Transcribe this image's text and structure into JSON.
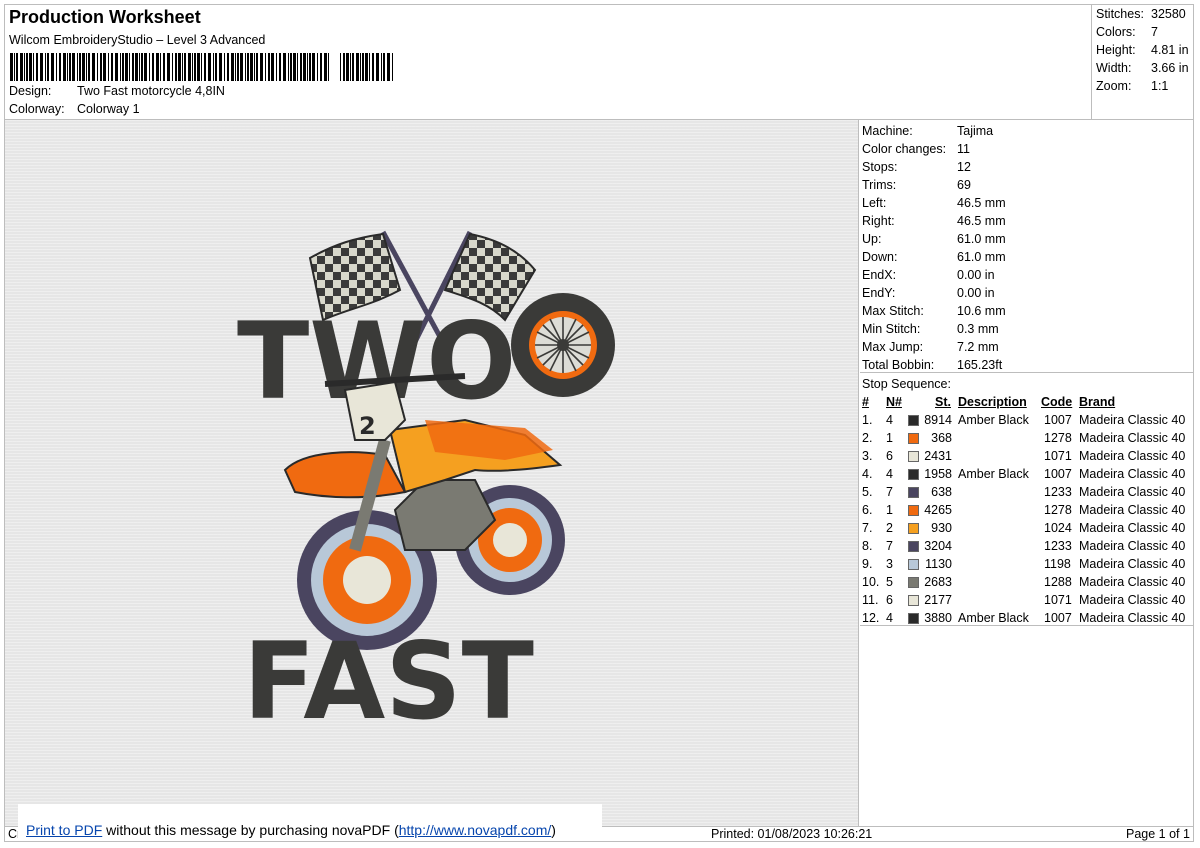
{
  "header": {
    "title": "Production Worksheet",
    "subtitle": "Wilcom EmbroideryStudio – Level 3 Advanced",
    "design_label": "Design:",
    "design_value": "Two Fast motorcycle 4,8IN",
    "colorway_label": "Colorway:",
    "colorway_value": "Colorway 1"
  },
  "summary": [
    {
      "label": "Stitches:",
      "value": "32580"
    },
    {
      "label": "Colors:",
      "value": "7"
    },
    {
      "label": "Height:",
      "value": "4.81 in"
    },
    {
      "label": "Width:",
      "value": "3.66 in"
    },
    {
      "label": "Zoom:",
      "value": "1:1"
    }
  ],
  "machine": [
    {
      "label": "Machine:",
      "value": "Tajima"
    },
    {
      "label": "Color changes:",
      "value": "11"
    },
    {
      "label": "Stops:",
      "value": "12"
    },
    {
      "label": "Trims:",
      "value": "69"
    },
    {
      "label": "Left:",
      "value": "46.5 mm"
    },
    {
      "label": "Right:",
      "value": "46.5 mm"
    },
    {
      "label": "Up:",
      "value": "61.0 mm"
    },
    {
      "label": "Down:",
      "value": "61.0 mm"
    },
    {
      "label": "EndX:",
      "value": "0.00 in"
    },
    {
      "label": "EndY:",
      "value": "0.00 in"
    },
    {
      "label": "Max Stitch:",
      "value": "10.6 mm"
    },
    {
      "label": "Min Stitch:",
      "value": "0.3 mm"
    },
    {
      "label": "Max Jump:",
      "value": "7.2 mm"
    },
    {
      "label": "Total Bobbin:",
      "value": "165.23ft"
    }
  ],
  "stop_sequence": {
    "title": "Stop Sequence:",
    "headers": {
      "num": "#",
      "n": "N#",
      "st": "St.",
      "desc": "Description",
      "code": "Code",
      "brand": "Brand"
    },
    "rows": [
      {
        "num": "1.",
        "n": "4",
        "color": "#2a2a2a",
        "st": "8914",
        "desc": "Amber Black",
        "code": "1007",
        "brand": "Madeira Classic 40"
      },
      {
        "num": "2.",
        "n": "1",
        "color": "#f06a10",
        "st": "368",
        "desc": "",
        "code": "1278",
        "brand": "Madeira Classic 40"
      },
      {
        "num": "3.",
        "n": "6",
        "color": "#e8e6d8",
        "st": "2431",
        "desc": "",
        "code": "1071",
        "brand": "Madeira Classic 40"
      },
      {
        "num": "4.",
        "n": "4",
        "color": "#2a2a2a",
        "st": "1958",
        "desc": "Amber Black",
        "code": "1007",
        "brand": "Madeira Classic 40"
      },
      {
        "num": "5.",
        "n": "7",
        "color": "#4a4560",
        "st": "638",
        "desc": "",
        "code": "1233",
        "brand": "Madeira Classic 40"
      },
      {
        "num": "6.",
        "n": "1",
        "color": "#f06a10",
        "st": "4265",
        "desc": "",
        "code": "1278",
        "brand": "Madeira Classic 40"
      },
      {
        "num": "7.",
        "n": "2",
        "color": "#f5a020",
        "st": "930",
        "desc": "",
        "code": "1024",
        "brand": "Madeira Classic 40"
      },
      {
        "num": "8.",
        "n": "7",
        "color": "#4a4560",
        "st": "3204",
        "desc": "",
        "code": "1233",
        "brand": "Madeira Classic 40"
      },
      {
        "num": "9.",
        "n": "3",
        "color": "#b8c8d8",
        "st": "1130",
        "desc": "",
        "code": "1198",
        "brand": "Madeira Classic 40"
      },
      {
        "num": "10.",
        "n": "5",
        "color": "#7a7a72",
        "st": "2683",
        "desc": "",
        "code": "1288",
        "brand": "Madeira Classic 40"
      },
      {
        "num": "11.",
        "n": "6",
        "color": "#e8e6d8",
        "st": "2177",
        "desc": "",
        "code": "1071",
        "brand": "Madeira Classic 40"
      },
      {
        "num": "12.",
        "n": "4",
        "color": "#2a2a2a",
        "st": "3880",
        "desc": "Amber Black",
        "code": "1007",
        "brand": "Madeira Classic 40"
      }
    ]
  },
  "design_preview": {
    "word_top": "TWO",
    "word_bottom": "FAST",
    "plate_number": "2"
  },
  "footer": {
    "left_cut": "Cr",
    "printed": "Printed: 01/08/2023 10:26:21",
    "page": "Page 1 of 1"
  },
  "banner": {
    "link1": "Print to PDF",
    "middle": " without this message by purchasing novaPDF (",
    "link2": "http://www.novapdf.com/",
    "end": ")"
  }
}
